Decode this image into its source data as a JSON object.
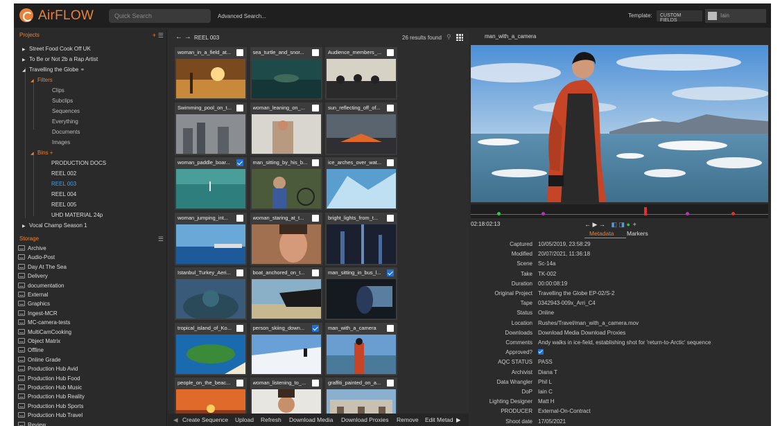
{
  "app": {
    "name": "AirFLOW",
    "search_placeholder": "Quick Search",
    "advanced_search": "Advanced Search...",
    "template_label": "Template:",
    "template_value": "CUSTOM FIELDS",
    "user": "Iain"
  },
  "projects": {
    "header": "Projects",
    "add": "+",
    "items": [
      {
        "label": "Street Food Cook Off UK"
      },
      {
        "label": "To Be or Not 2b a Rap Artist"
      },
      {
        "label": "Travelling the Globe"
      },
      {
        "label": "Filters"
      },
      {
        "label": "Clips"
      },
      {
        "label": "Subclips"
      },
      {
        "label": "Sequences"
      },
      {
        "label": "Everything"
      },
      {
        "label": "Documents"
      },
      {
        "label": "Images"
      },
      {
        "label": "Bins"
      },
      {
        "label": "PRODUCTION DOCS"
      },
      {
        "label": "REEL 002"
      },
      {
        "label": "REEL 003"
      },
      {
        "label": "REEL 004"
      },
      {
        "label": "REEL 005"
      },
      {
        "label": "UHD MATERIAL 24p"
      },
      {
        "label": "Vocal Champ Season 1"
      }
    ]
  },
  "storage": {
    "header": "Storage",
    "items": [
      "Archive",
      "Audio-Post",
      "Day At The Sea",
      "Delivery",
      "documentation",
      "External",
      "Graphics",
      "Ingest-MCR",
      "MC-camera-tests",
      "MultiCamCooking",
      "Object Matrix",
      "Offline",
      "Online Grade",
      "Production Hub Avid",
      "Production Hub Food",
      "Production Hub Music",
      "Production Hub Reality",
      "Production Hub Sports",
      "Production Hub Travel",
      "Review"
    ]
  },
  "browser": {
    "title": "REEL 003",
    "results": "26 results found",
    "thumbs": [
      {
        "name": "woman_in_a_field_at...",
        "checked": false,
        "scene": "sunset"
      },
      {
        "name": "sea_turtle_and_snor...",
        "checked": false,
        "scene": "ocean-dark"
      },
      {
        "name": "Audience_members_...",
        "checked": false,
        "scene": "crowd"
      },
      {
        "name": "Swimming_pool_on_t...",
        "checked": false,
        "scene": "city-grey"
      },
      {
        "name": "woman_leaning_on_...",
        "checked": false,
        "scene": "room-light"
      },
      {
        "name": "sun_reflecting_off_of...",
        "checked": false,
        "scene": "lava"
      },
      {
        "name": "woman_paddle_boar...",
        "checked": true,
        "scene": "teal-sea"
      },
      {
        "name": "man_sitting_by_his_b...",
        "checked": false,
        "scene": "cyclist"
      },
      {
        "name": "ice_arches_over_wat...",
        "checked": false,
        "scene": "ice-blue"
      },
      {
        "name": "woman_jumping_int...",
        "checked": false,
        "scene": "sea-blue"
      },
      {
        "name": "woman_staring_at_t...",
        "checked": false,
        "scene": "portrait-warm"
      },
      {
        "name": "bright_lights_from_t...",
        "checked": false,
        "scene": "city-night"
      },
      {
        "name": "Istanbul_Turkey_Aeri...",
        "checked": false,
        "scene": "mosque"
      },
      {
        "name": "boat_anchored_on_t...",
        "checked": false,
        "scene": "boat"
      },
      {
        "name": "man_sitting_in_bus_l...",
        "checked": true,
        "scene": "bus-dark"
      },
      {
        "name": "tropical_island_of_Ko...",
        "checked": false,
        "scene": "island"
      },
      {
        "name": "person_skiing_down...",
        "checked": true,
        "scene": "snow"
      },
      {
        "name": "man_with_a_camera",
        "checked": false,
        "scene": "ice-man"
      },
      {
        "name": "people_on_the_beac...",
        "checked": false,
        "scene": "beach-sunset"
      },
      {
        "name": "woman_listening_to_...",
        "checked": false,
        "scene": "portrait-light"
      },
      {
        "name": "graffiti_painted_on_a...",
        "checked": false,
        "scene": "building"
      }
    ],
    "actions": [
      "Create Sequence",
      "Upload",
      "Refresh",
      "Download Media",
      "Download Proxies",
      "Remove",
      "Edit Metad"
    ]
  },
  "viewer": {
    "clip_title": "man_with_a_camera",
    "timecode": "02:18:02:13",
    "transport": "← ▶ →",
    "tabs": [
      "Metadata",
      "Markers"
    ],
    "metadata": [
      {
        "k": "Captured",
        "v": "10/05/2019, 23:58:29"
      },
      {
        "k": "Modified",
        "v": "20/07/2021, 11:36:18"
      },
      {
        "k": "Scene",
        "v": "Sc-14a"
      },
      {
        "k": "Take",
        "v": "TK-002"
      },
      {
        "k": "Duration",
        "v": "00:00:08:19"
      },
      {
        "k": "Original Project",
        "v": "Travelling the Globe EP-02/S-2"
      },
      {
        "k": "Tape",
        "v": "0342943-009x_Arri_C4"
      },
      {
        "k": "Status",
        "v": "Online"
      },
      {
        "k": "Location",
        "v": "Rushes/Travel/man_with_a_camera.mov"
      },
      {
        "k": "Downloads",
        "v": "Download Media    Download Proxies"
      },
      {
        "k": "Comments",
        "v": "Andy walks in ice-field, establishing shot for 'return-to-Arctic' sequence"
      },
      {
        "k": "Approved?",
        "v": ""
      },
      {
        "k": "AQC STATUS",
        "v": "PASS"
      },
      {
        "k": "Archivist",
        "v": "Diana T"
      },
      {
        "k": "Data Wrangler",
        "v": "Phil L"
      },
      {
        "k": "DoP",
        "v": "Iain C"
      },
      {
        "k": "Lighting Designer",
        "v": "Matt H"
      },
      {
        "k": "PRODUCER",
        "v": "External-On-Contract"
      },
      {
        "k": "Shoot date",
        "v": "17/05/2021"
      }
    ]
  },
  "colors": {
    "accent": "#e8813a",
    "selected": "#4a9fe0",
    "checkbox": "#1e6fd6"
  }
}
